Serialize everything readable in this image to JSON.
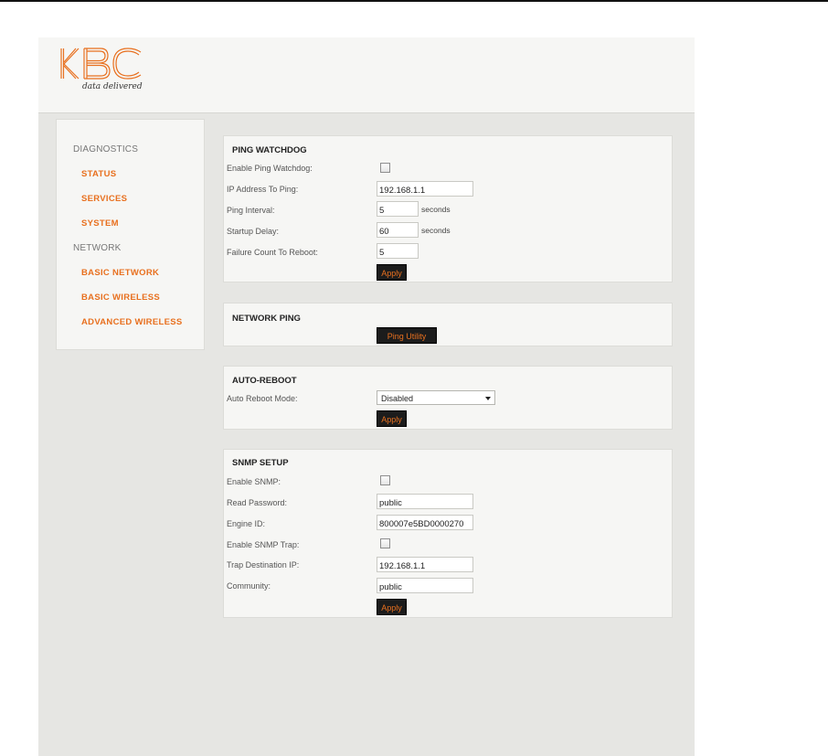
{
  "brand": {
    "logo_text": "KBC",
    "tagline": "data delivered",
    "accent_color": "#e8701f"
  },
  "sidebar": {
    "items": [
      {
        "label": "DIAGNOSTICS",
        "kind": "header"
      },
      {
        "label": "STATUS",
        "kind": "link"
      },
      {
        "label": "SERVICES",
        "kind": "link"
      },
      {
        "label": "SYSTEM",
        "kind": "link"
      },
      {
        "label": "NETWORK",
        "kind": "header"
      },
      {
        "label": "BASIC NETWORK",
        "kind": "link"
      },
      {
        "label": "BASIC WIRELESS",
        "kind": "link"
      },
      {
        "label": "ADVANCED WIRELESS",
        "kind": "link"
      }
    ]
  },
  "ping_watchdog": {
    "title": "PING WATCHDOG",
    "enable_label": "Enable Ping Watchdog:",
    "enable_checked": false,
    "ip_label": "IP Address To Ping:",
    "ip_value": "192.168.1.1",
    "interval_label": "Ping Interval:",
    "interval_value": "5",
    "interval_unit": "seconds",
    "startup_label": "Startup Delay:",
    "startup_value": "60",
    "startup_unit": "seconds",
    "failure_label": "Failure Count To Reboot:",
    "failure_value": "5",
    "apply_label": "Apply"
  },
  "network_ping": {
    "title": "NETWORK PING",
    "button_label": "Ping Utility"
  },
  "auto_reboot": {
    "title": "AUTO-REBOOT",
    "mode_label": "Auto Reboot Mode:",
    "mode_value": "Disabled",
    "apply_label": "Apply"
  },
  "snmp": {
    "title": "SNMP SETUP",
    "enable_label": "Enable SNMP:",
    "enable_checked": false,
    "read_pw_label": "Read Password:",
    "read_pw_value": "public",
    "engine_label": "Engine ID:",
    "engine_value": "800007e5BD0000270",
    "trap_label": "Enable SNMP Trap:",
    "trap_checked": false,
    "trap_ip_label": "Trap Destination IP:",
    "trap_ip_value": "192.168.1.1",
    "community_label": "Community:",
    "community_value": "public",
    "apply_label": "Apply"
  }
}
